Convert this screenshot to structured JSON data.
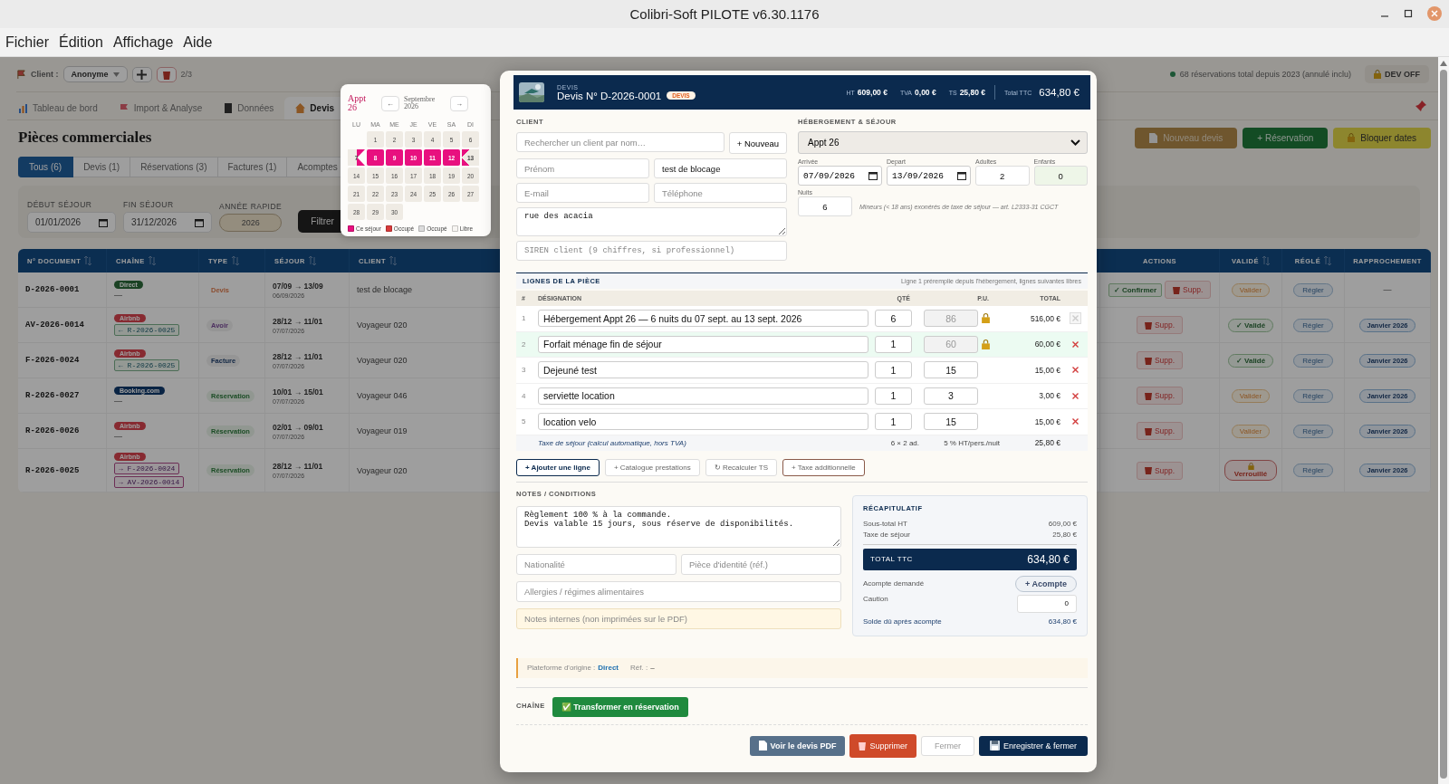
{
  "window": {
    "title": "Colibri-Soft PILOTE v6.30.1176"
  },
  "menu": [
    "Fichier",
    "Édition",
    "Affichage",
    "Aide"
  ],
  "toolbar": {
    "client_label": "Client :",
    "client_value": "Anonyme",
    "counter": "2/3",
    "stats": "68 réservations total depuis 2023 (annulé inclu)",
    "dev_button": "DEV OFF"
  },
  "nav_tabs": [
    {
      "label": "Tableau de bord",
      "selected": false
    },
    {
      "label": "Import & Analyse",
      "selected": false
    },
    {
      "label": "Données",
      "selected": false
    },
    {
      "label": "Devis",
      "selected": true
    }
  ],
  "page": {
    "title": "Pièces commerciales",
    "actions": [
      {
        "label": "Nouveau devis",
        "kind": "devis"
      },
      {
        "label": "+ Réservation",
        "kind": "reservation"
      },
      {
        "label": "Bloquer dates",
        "kind": "block"
      }
    ]
  },
  "filter_tabs": [
    {
      "label": "Tous (6)",
      "selected": true
    },
    {
      "label": "Devis (1)",
      "selected": false
    },
    {
      "label": "Réservations (3)",
      "selected": false
    },
    {
      "label": "Factures (1)",
      "selected": false
    },
    {
      "label": "Acomptes",
      "selected": false
    }
  ],
  "filters": {
    "start_label": "DÉBUT SÉJOUR",
    "start": "01/01/2026",
    "end_label": "FIN SÉJOUR",
    "end": "31/12/2026",
    "year_label": "ANNÉE RAPIDE",
    "year": "2026",
    "button": "Filtrer"
  },
  "table": {
    "columns": [
      "N° DOCUMENT",
      "CHAÎNE",
      "TYPE",
      "SÉJOUR",
      "CLIENT",
      "ACTIONS",
      "VALIDÉ",
      "RÉGLÉ",
      "RAPPROCHEMENT"
    ],
    "rows": [
      {
        "number": "D-2026-0001",
        "channel": {
          "label": "Direct",
          "kind": "direct"
        },
        "note": "—",
        "type": {
          "label": "Devis",
          "kind": "devis"
        },
        "stay": "07/09 → 13/09",
        "stay_date": "06/09/2026",
        "client": "test de blocage",
        "confirm": "✓ Confirmer",
        "delete": "Supp.",
        "validated": {
          "label": "Valider",
          "kind": "todo"
        },
        "settle": "Régler",
        "reconciliation": {
          "label": "—",
          "kind": "none"
        }
      },
      {
        "number": "AV-2026-0014",
        "channel": {
          "label": "Airbnb",
          "kind": "airbnb"
        },
        "links": [
          {
            "label": "← R-2026-0025",
            "kind": "source"
          }
        ],
        "type": {
          "label": "Avoir",
          "kind": "avoir"
        },
        "stay": "28/12 → 11/01",
        "stay_date": "07/07/2026",
        "client": "Voyageur 020",
        "delete": "Supp.",
        "validated": {
          "label": "✓ Validé",
          "kind": "done"
        },
        "settle": "Régler",
        "reconciliation": {
          "label": "Janvier 2026",
          "kind": "month"
        }
      },
      {
        "number": "F-2026-0024",
        "channel": {
          "label": "Airbnb",
          "kind": "airbnb"
        },
        "links": [
          {
            "label": "← R-2026-0025",
            "kind": "source"
          }
        ],
        "type": {
          "label": "Facture",
          "kind": "facture"
        },
        "stay": "28/12 → 11/01",
        "stay_date": "07/07/2026",
        "client": "Voyageur 020",
        "delete": "Supp.",
        "validated": {
          "label": "✓ Validé",
          "kind": "done"
        },
        "settle": "Régler",
        "reconciliation": {
          "label": "Janvier 2026",
          "kind": "month"
        }
      },
      {
        "number": "R-2026-0027",
        "channel": {
          "label": "Booking.com",
          "kind": "booking"
        },
        "note": "—",
        "type": {
          "label": "Réservation",
          "kind": "reservation"
        },
        "stay": "10/01 → 15/01",
        "stay_date": "07/07/2026",
        "client": "Voyageur 046",
        "delete": "Supp.",
        "validated": {
          "label": "Valider",
          "kind": "todo"
        },
        "settle": "Régler",
        "reconciliation": {
          "label": "Janvier 2026",
          "kind": "month"
        }
      },
      {
        "number": "R-2026-0026",
        "channel": {
          "label": "Airbnb",
          "kind": "airbnb"
        },
        "note": "—",
        "type": {
          "label": "Réservation",
          "kind": "reservation"
        },
        "stay": "02/01 → 09/01",
        "stay_date": "07/07/2026",
        "client": "Voyageur 019",
        "delete": "Supp.",
        "validated": {
          "label": "Valider",
          "kind": "todo"
        },
        "settle": "Régler",
        "reconciliation": {
          "label": "Janvier 2026",
          "kind": "month"
        }
      },
      {
        "number": "R-2026-0025",
        "channel": {
          "label": "Airbnb",
          "kind": "airbnb"
        },
        "links": [
          {
            "label": "→ F-2026-0024",
            "kind": "target"
          },
          {
            "label": "→ AV-2026-0014",
            "kind": "target"
          }
        ],
        "type": {
          "label": "Réservation",
          "kind": "reservation"
        },
        "stay": "28/12 → 11/01",
        "stay_date": "07/07/2026",
        "client": "Voyageur 020",
        "delete": "Supp.",
        "validated": {
          "label": "Verrouillé",
          "kind": "locked"
        },
        "settle": "Régler",
        "reconciliation": {
          "label": "Janvier 2026",
          "kind": "month"
        }
      }
    ]
  },
  "calendar": {
    "unit": "Appt 26",
    "month": "Septembre 2026",
    "prev": "←",
    "next": "→",
    "weekdays": [
      "LU",
      "MA",
      "ME",
      "JE",
      "VE",
      "SA",
      "DI"
    ],
    "weeks": [
      [
        {
          "kind": "blank"
        },
        {
          "day": "1",
          "kind": "free"
        },
        {
          "day": "2",
          "kind": "free"
        },
        {
          "day": "3",
          "kind": "free"
        },
        {
          "day": "4",
          "kind": "free"
        },
        {
          "day": "5",
          "kind": "free"
        },
        {
          "day": "6",
          "kind": "free"
        }
      ],
      [
        {
          "day": "7",
          "kind": "check_in"
        },
        {
          "day": "8",
          "kind": "stay"
        },
        {
          "day": "9",
          "kind": "stay"
        },
        {
          "day": "10",
          "kind": "stay"
        },
        {
          "day": "11",
          "kind": "stay"
        },
        {
          "day": "12",
          "kind": "stay"
        },
        {
          "day": "13",
          "kind": "check_out"
        }
      ],
      [
        {
          "day": "14",
          "kind": "free"
        },
        {
          "day": "15",
          "kind": "free"
        },
        {
          "day": "16",
          "kind": "free"
        },
        {
          "day": "17",
          "kind": "free"
        },
        {
          "day": "18",
          "kind": "free"
        },
        {
          "day": "19",
          "kind": "free"
        },
        {
          "day": "20",
          "kind": "free"
        }
      ],
      [
        {
          "day": "21",
          "kind": "free"
        },
        {
          "day": "22",
          "kind": "free"
        },
        {
          "day": "23",
          "kind": "free"
        },
        {
          "day": "24",
          "kind": "free"
        },
        {
          "day": "25",
          "kind": "free"
        },
        {
          "day": "26",
          "kind": "free"
        },
        {
          "day": "27",
          "kind": "free"
        }
      ],
      [
        {
          "day": "28",
          "kind": "free"
        },
        {
          "day": "29",
          "kind": "free"
        },
        {
          "day": "30",
          "kind": "free"
        }
      ]
    ],
    "legend": [
      {
        "label": "Ce séjour",
        "color": "#e8107f"
      },
      {
        "label": "Occupé",
        "color": "#d93a3a"
      },
      {
        "label": "Occupé",
        "color": "#dcdcdc"
      },
      {
        "label": "Libre",
        "color": "#f7f5f2"
      }
    ]
  },
  "quote": {
    "header": {
      "kicker": "DEVIS",
      "title": "Devis N° D-2026-0001",
      "badge": "DEVIS",
      "totals": [
        {
          "label": "HT",
          "value": "609,00 €"
        },
        {
          "label": "TVA",
          "value": "0,00 €"
        },
        {
          "label": "TS",
          "value": "25,80 €"
        }
      ],
      "total_label": "Total TTC",
      "total": "634,80 €"
    },
    "client": {
      "section": "CLIENT",
      "search_placeholder": "Rechercher un client par nom…",
      "new_button": "+ Nouveau",
      "first_name_placeholder": "Prénom",
      "last_name": "test de blocage",
      "email_placeholder": "E-mail",
      "phone_placeholder": "Téléphone",
      "address": "rue des acacia",
      "siren_placeholder": "SIREN client (9 chiffres, si professionnel)"
    },
    "stay": {
      "section": "HÉBERGEMENT & SÉJOUR",
      "unit": "Appt 26",
      "arrival_label": "Arrivée",
      "arrival": "07/09/2026",
      "departure_label": "Depart",
      "departure": "13/09/2026",
      "adults_label": "Adultes",
      "adults": "2",
      "children_label": "Enfants",
      "children": "0",
      "nights_label": "Nuits",
      "nights": "6",
      "note": "Mineurs (< 18 ans) exonérés de taxe de séjour — art. L2333-31 CGCT"
    },
    "lines": {
      "section": "LIGNES DE LA PIÈCE",
      "hint": "Ligne 1 préremplie depuis l'hébergement, lignes suivantes libres",
      "columns": [
        "#",
        "DÉSIGNATION",
        "QTÉ",
        "P.U.",
        "TOTAL"
      ],
      "items": [
        {
          "index": "1",
          "designation": "Hébergement Appt 26 — 6 nuits du 07 sept. au 13 sept. 2026",
          "qty": "6",
          "price": "86",
          "locked": true,
          "total": "516,00 €",
          "removable": false,
          "highlighted": false
        },
        {
          "index": "2",
          "designation": "Forfait ménage fin de séjour",
          "qty": "1",
          "price": "60",
          "locked": true,
          "total": "60,00 €",
          "removable": true,
          "highlighted": true
        },
        {
          "index": "3",
          "designation": "Dejeuné test",
          "qty": "1",
          "price": "15",
          "locked": false,
          "total": "15,00 €",
          "removable": true,
          "highlighted": false
        },
        {
          "index": "4",
          "designation": "serviette location",
          "qty": "1",
          "price": "3",
          "locked": false,
          "total": "3,00 €",
          "removable": true,
          "highlighted": false
        },
        {
          "index": "5",
          "designation": "location velo",
          "qty": "1",
          "price": "15",
          "locked": false,
          "total": "15,00 €",
          "removable": true,
          "highlighted": false
        }
      ],
      "tax": {
        "label": "Taxe de séjour (calcul automatique, hors TVA)",
        "qty": "6 × 2 ad.",
        "rate": "5 % HT/pers./nuit",
        "total": "25,80 €"
      },
      "buttons": [
        {
          "label": "+ Ajouter une ligne",
          "kind": "primary"
        },
        {
          "label": "+ Catalogue prestations",
          "kind": "plain"
        },
        {
          "label": "↻ Recalculer TS",
          "kind": "plain"
        },
        {
          "label": "+ Taxe additionnelle",
          "kind": "tax"
        }
      ]
    },
    "notes": {
      "section": "NOTES / CONDITIONS",
      "text": "Règlement 100 % à la commande.\nDevis valable 15 jours, sous réserve de disponibilités.",
      "nationality_placeholder": "Nationalité",
      "id_placeholder": "Pièce d'identité (réf.)",
      "allergies_placeholder": "Allergies / régimes alimentaires",
      "internal_placeholder": "Notes internes (non imprimées sur le PDF)"
    },
    "summary": {
      "title": "RÉCAPITULATIF",
      "rows": [
        {
          "label": "Sous-total HT",
          "value": "609,00 €"
        },
        {
          "label": "Taxe de séjour",
          "value": "25,80 €"
        }
      ],
      "total_label": "TOTAL TTC",
      "total": "634,80 €",
      "deposit_label": "Acompte demandé",
      "deposit_button": "+ Acompte",
      "caution_label": "Caution",
      "caution": "0",
      "balance_label": "Solde dû après acompte",
      "balance": "634,80 €"
    },
    "origin": {
      "label": "Plateforme d'origine :",
      "platform": "Direct",
      "ref_label": "Réf. :",
      "ref": "–"
    },
    "chain": {
      "label": "CHAÎNE",
      "button": "✅ Transformer en réservation"
    },
    "footer": [
      {
        "label": "Voir le devis PDF",
        "kind": "pdf"
      },
      {
        "label": "Supprimer",
        "kind": "delete"
      },
      {
        "label": "Fermer",
        "kind": "close"
      },
      {
        "label": "Enregistrer & fermer",
        "kind": "save"
      }
    ]
  }
}
